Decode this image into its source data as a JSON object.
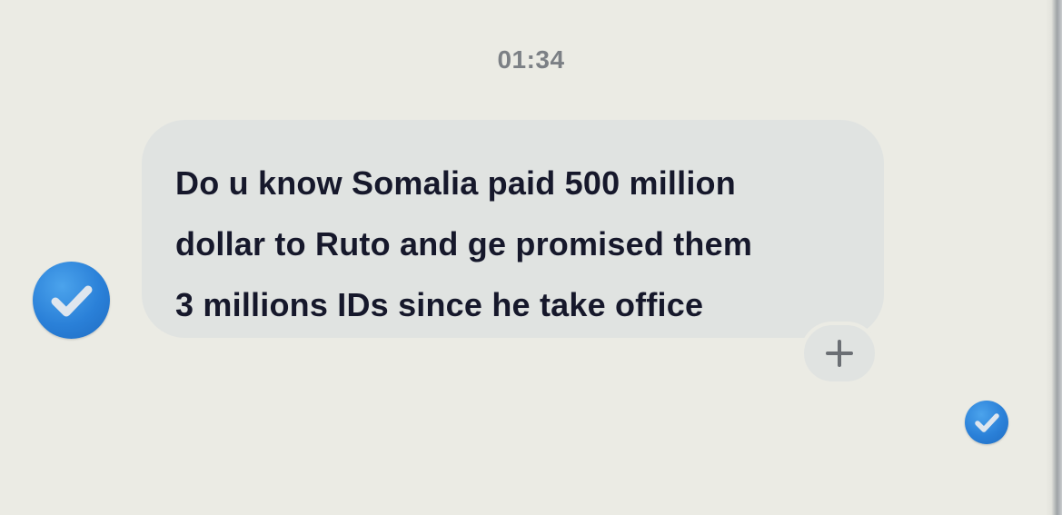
{
  "conversation": {
    "timestamp": "01:34",
    "messages": [
      {
        "lines": [
          "Do u know Somalia paid 500 million",
          "dollar to Ruto and ge promised them",
          "3 millions IDs since he take office"
        ],
        "selected": true
      }
    ],
    "add_reaction_icon": "plus-icon",
    "selection_icon": "checkmark-circle-icon"
  },
  "colors": {
    "background": "#ebebe4",
    "bubble": "#e0e3e1",
    "text": "#16182b",
    "timestamp": "#7c8085",
    "accent": "#2a80d8"
  }
}
